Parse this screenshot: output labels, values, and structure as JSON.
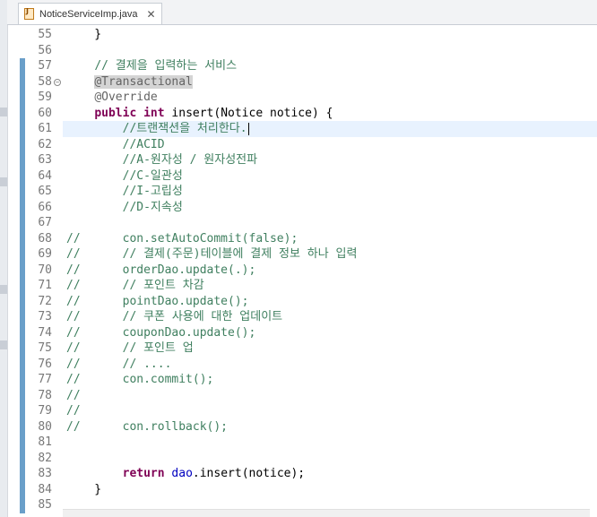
{
  "tab": {
    "filename": "NoticeServiceImp.java",
    "close": "✕"
  },
  "lines": [
    {
      "n": "55",
      "t": [
        [
          "plain",
          "    }"
        ]
      ]
    },
    {
      "n": "56",
      "t": []
    },
    {
      "n": "57",
      "t": [
        [
          "plain",
          "    "
        ],
        [
          "cm",
          "// 결제을 입력하는 서비스"
        ]
      ]
    },
    {
      "n": "58",
      "t": [
        [
          "plain",
          "    "
        ],
        [
          "ann ann-hl",
          "@Transactional"
        ]
      ],
      "fold": true
    },
    {
      "n": "59",
      "t": [
        [
          "plain",
          "    "
        ],
        [
          "ann",
          "@Override"
        ]
      ]
    },
    {
      "n": "60",
      "t": [
        [
          "plain",
          "    "
        ],
        [
          "kw",
          "public"
        ],
        [
          "plain",
          " "
        ],
        [
          "kw",
          "int"
        ],
        [
          "plain",
          " insert(Notice "
        ],
        [
          "plain",
          "notice) {"
        ]
      ]
    },
    {
      "n": "61",
      "t": [
        [
          "plain",
          "        "
        ],
        [
          "cm",
          "//트랜잭션을 처리한다."
        ]
      ],
      "current": true
    },
    {
      "n": "62",
      "t": [
        [
          "plain",
          "        "
        ],
        [
          "cm",
          "//ACID"
        ]
      ]
    },
    {
      "n": "63",
      "t": [
        [
          "plain",
          "        "
        ],
        [
          "cm",
          "//A-원자성 / 원자성전파"
        ]
      ]
    },
    {
      "n": "64",
      "t": [
        [
          "plain",
          "        "
        ],
        [
          "cm",
          "//C-일관성"
        ]
      ]
    },
    {
      "n": "65",
      "t": [
        [
          "plain",
          "        "
        ],
        [
          "cm",
          "//I-고립성"
        ]
      ]
    },
    {
      "n": "66",
      "t": [
        [
          "plain",
          "        "
        ],
        [
          "cm",
          "//D-지속성"
        ]
      ]
    },
    {
      "n": "67",
      "t": []
    },
    {
      "n": "68",
      "t": [
        [
          "cm",
          "//      con.setAutoCommit(false);"
        ]
      ]
    },
    {
      "n": "69",
      "t": [
        [
          "cm",
          "//      // 결제(주문)테이블에 결제 정보 하나 입력"
        ]
      ]
    },
    {
      "n": "70",
      "t": [
        [
          "cm",
          "//      orderDao.update(.);"
        ]
      ]
    },
    {
      "n": "71",
      "t": [
        [
          "cm",
          "//      // 포인트 차감"
        ]
      ]
    },
    {
      "n": "72",
      "t": [
        [
          "cm",
          "//      pointDao.update();"
        ]
      ]
    },
    {
      "n": "73",
      "t": [
        [
          "cm",
          "//      // 쿠폰 사용에 대한 업데이트"
        ]
      ]
    },
    {
      "n": "74",
      "t": [
        [
          "cm",
          "//      couponDao.update();"
        ]
      ]
    },
    {
      "n": "75",
      "t": [
        [
          "cm",
          "//      // 포인트 업"
        ]
      ]
    },
    {
      "n": "76",
      "t": [
        [
          "cm",
          "//      // ...."
        ]
      ]
    },
    {
      "n": "77",
      "t": [
        [
          "cm",
          "//      con.commit();"
        ]
      ]
    },
    {
      "n": "78",
      "t": [
        [
          "cm",
          "//"
        ]
      ]
    },
    {
      "n": "79",
      "t": [
        [
          "cm",
          "//"
        ]
      ]
    },
    {
      "n": "80",
      "t": [
        [
          "cm",
          "//      con.rollback();"
        ]
      ]
    },
    {
      "n": "81",
      "t": []
    },
    {
      "n": "82",
      "t": []
    },
    {
      "n": "83",
      "t": [
        [
          "plain",
          "        "
        ],
        [
          "kw",
          "return"
        ],
        [
          "plain",
          " "
        ],
        [
          "field",
          "dao"
        ],
        [
          "plain",
          ".insert(notice);"
        ]
      ]
    },
    {
      "n": "84",
      "t": [
        [
          "plain",
          "    }"
        ]
      ]
    },
    {
      "n": "85",
      "t": []
    }
  ],
  "colors": {
    "keyword": "#7f0055",
    "comment": "#3f7f5f",
    "annotation": "#646464",
    "changebar": "#6a9fc9",
    "current_line": "#e8f2fe"
  }
}
